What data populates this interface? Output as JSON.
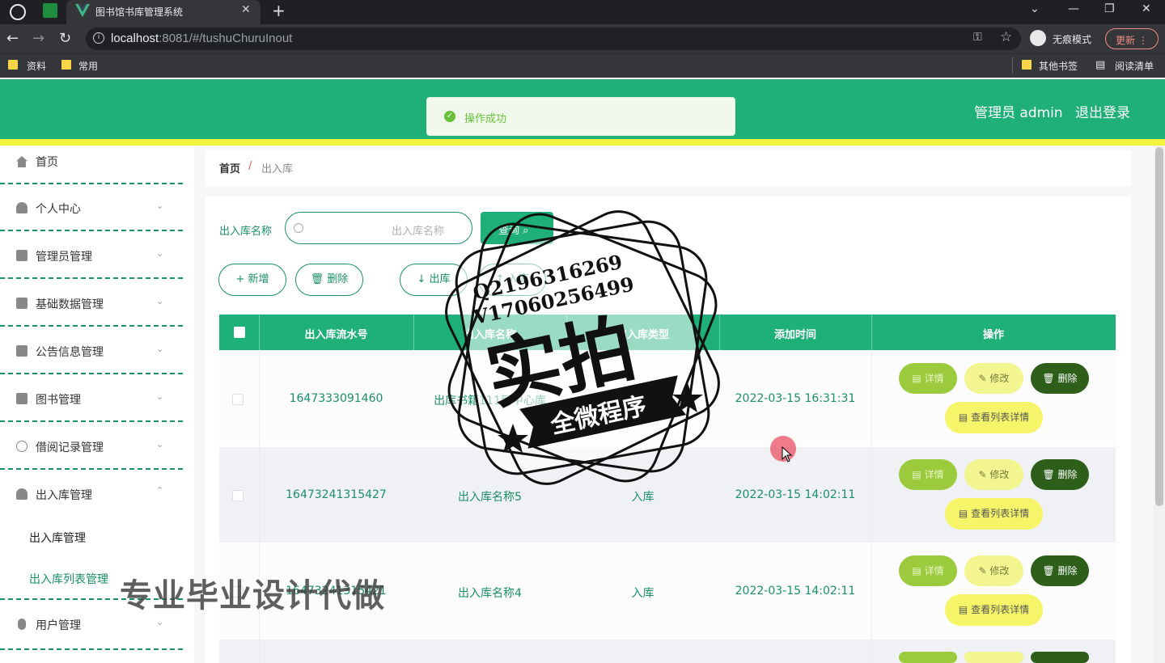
{
  "browser": {
    "tab_title": "图书馆书库管理系统",
    "url_host": "localhost",
    "url_rest": ":8081/#/tushuChuruInout",
    "incognito_label": "无痕模式",
    "update_label": "更新",
    "bookmarks": [
      "资料",
      "常用"
    ],
    "bookmarks_right": [
      "其他书签",
      "阅读清单"
    ]
  },
  "header": {
    "user": "管理员 admin",
    "logout": "退出登录",
    "toast": "操作成功",
    "colors": {
      "primary": "#1fb07a",
      "accent": "#f2f53b"
    }
  },
  "sidebar": {
    "items": [
      {
        "label": "首页",
        "icon": "home-icon"
      },
      {
        "label": "个人中心",
        "icon": "user-icon"
      },
      {
        "label": "管理员管理",
        "icon": "flag-icon"
      },
      {
        "label": "基础数据管理",
        "icon": "chart-icon"
      },
      {
        "label": "公告信息管理",
        "icon": "notice-icon"
      },
      {
        "label": "图书管理",
        "icon": "book-icon"
      },
      {
        "label": "借阅记录管理",
        "icon": "globe-icon"
      },
      {
        "label": "出入库管理",
        "icon": "user-icon"
      },
      {
        "label": "用户管理",
        "icon": "mic-icon"
      }
    ],
    "submenu": [
      "出入库管理",
      "出入库列表管理"
    ]
  },
  "breadcrumb": {
    "home": "首页",
    "sep": "/",
    "current": "出入库"
  },
  "search": {
    "label": "出入库名称",
    "placeholder": "出入库名称",
    "query_button": "查询"
  },
  "actions": {
    "add": "+ 新增",
    "delete": "删除",
    "out": "出库",
    "in": "入库"
  },
  "table": {
    "headers": [
      "出入库流水号",
      "出入库名称",
      "出入库类型",
      "添加时间",
      "操作"
    ],
    "rows": [
      {
        "serial": "1647333091460",
        "name": "出库书籍111到中心库",
        "type": "",
        "time": "2022-03-15 16:31:31"
      },
      {
        "serial": "16473241315427",
        "name": "出入库名称5",
        "type": "入库",
        "time": "2022-03-15 14:02:11"
      },
      {
        "serial": "16473241315421",
        "name": "出入库名称4",
        "type": "入库",
        "time": "2022-03-15 14:02:11"
      }
    ],
    "row_buttons": {
      "detail": "详情",
      "edit": "修改",
      "delete": "删除",
      "list_detail": "查看列表详情"
    }
  },
  "watermark": {
    "line1": "Q2196316269",
    "line2": "V17060256499",
    "big": "实拍",
    "banner": "全微程序",
    "bottom": "专业毕业设计代做"
  }
}
